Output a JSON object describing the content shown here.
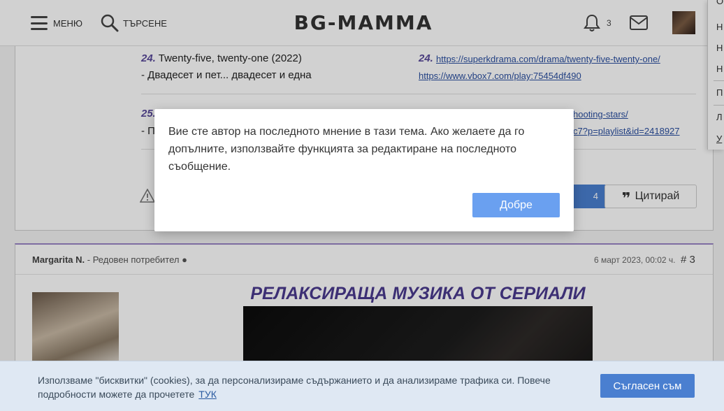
{
  "header": {
    "menu_label": "МЕНЮ",
    "search_label": "ТЪРСЕНЕ",
    "logo_text": "BG-MAMMA",
    "notifications_count": "3"
  },
  "side_menu": {
    "items": [
      "О",
      "Н",
      "Н",
      "Н",
      "П",
      "Л",
      "У"
    ]
  },
  "post1": {
    "rows": [
      {
        "num": "24.",
        "title": "Twenty-five, twenty-one (2022)",
        "subtitle": "-  Двадесет и пет... двадесет и една",
        "link_num": "24.",
        "link1": "https://superkdrama.com/drama/twenty-five-twenty-one/",
        "link2": "https://www.vbox7.com/play:75454df490"
      },
      {
        "num": "25.",
        "title": "",
        "subtitle": "-  П",
        "link_num": "",
        "link1": "hooting-stars/",
        "link2": "c7?p=playlist&id=2418927"
      }
    ],
    "like_count": "4",
    "quote_label": "Цитирай"
  },
  "post2": {
    "author": "Margarita N.",
    "role": " - Редовен потребител ●",
    "date": "6 март 2023, 00:02 ч.",
    "number": "# 3",
    "banner_title": "РЕЛАКСИРАЩА МУЗИКА ОТ СЕРИАЛИ"
  },
  "modal": {
    "message": "Вие сте автор на последното мнение в тази тема. Ако желаете да го допълните, използвайте функцията за редактиране на последното съобщение.",
    "ok_label": "Добре"
  },
  "cookie": {
    "text": "Използваме \"бисквитки\" (cookies), за да персонализираме съдържанието и да анализираме трафика си. Повече подробности можете да прочетете",
    "link_label": "ТУК",
    "accept_label": "Съгласен съм"
  },
  "colors": {
    "accent_blue": "#4a7fd0",
    "modal_button": "#6aa0f0",
    "purple_title": "#4a3a8e",
    "cookie_bg": "#dfe8f3"
  }
}
